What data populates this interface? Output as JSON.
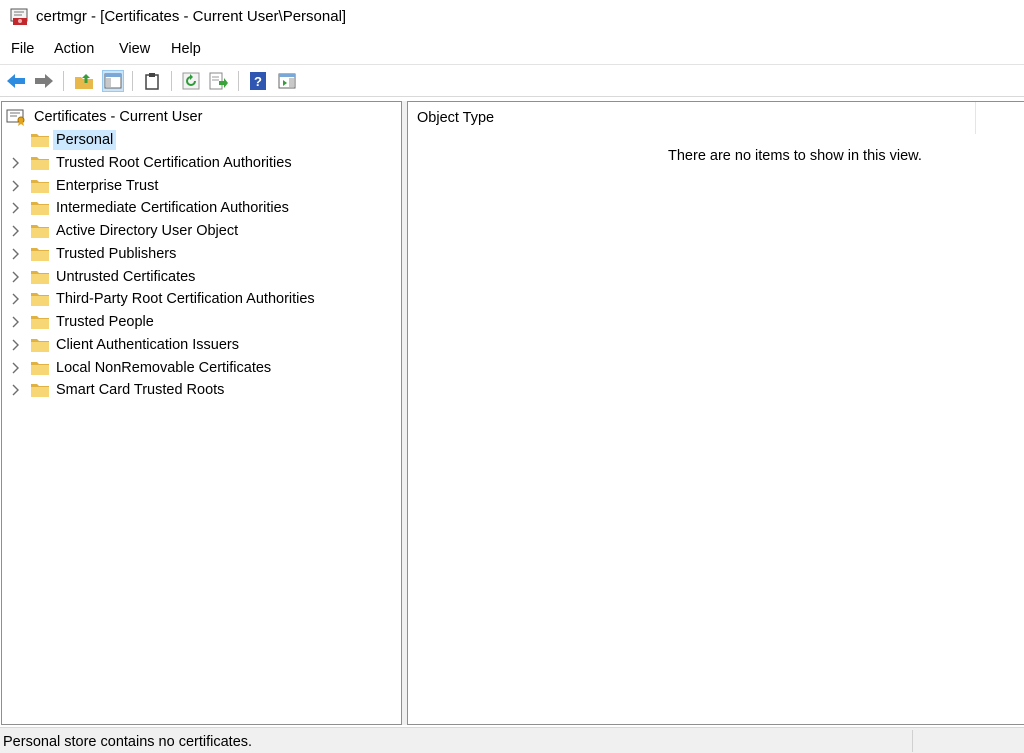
{
  "window": {
    "title": "certmgr - [Certificates - Current User\\Personal]"
  },
  "menu": [
    "File",
    "Action",
    "View",
    "Help"
  ],
  "toolbar": {
    "buttons": [
      "back-icon",
      "forward-icon",
      "up-folder-icon",
      "show-hide-tree-icon",
      "clipboard-icon",
      "refresh-icon",
      "export-list-icon",
      "help-icon",
      "action-pane-icon"
    ]
  },
  "tree": {
    "root": "Certificates - Current User",
    "items": [
      {
        "label": "Personal",
        "selected": true,
        "expandable": false
      },
      {
        "label": "Trusted Root Certification Authorities",
        "expandable": true
      },
      {
        "label": "Enterprise Trust",
        "expandable": true
      },
      {
        "label": "Intermediate Certification Authorities",
        "expandable": true
      },
      {
        "label": "Active Directory User Object",
        "expandable": true
      },
      {
        "label": "Trusted Publishers",
        "expandable": true
      },
      {
        "label": "Untrusted Certificates",
        "expandable": true
      },
      {
        "label": "Third-Party Root Certification Authorities",
        "expandable": true
      },
      {
        "label": "Trusted People",
        "expandable": true
      },
      {
        "label": "Client Authentication Issuers",
        "expandable": true
      },
      {
        "label": "Local NonRemovable Certificates",
        "expandable": true
      },
      {
        "label": "Smart Card Trusted Roots",
        "expandable": true
      }
    ]
  },
  "list": {
    "column": "Object Type",
    "empty_message": "There are no items to show in this view."
  },
  "status": {
    "text": "Personal store contains no certificates."
  },
  "colors": {
    "selection": "#cce8ff",
    "folder": "#f7d675",
    "folder_dark": "#e0b243"
  }
}
